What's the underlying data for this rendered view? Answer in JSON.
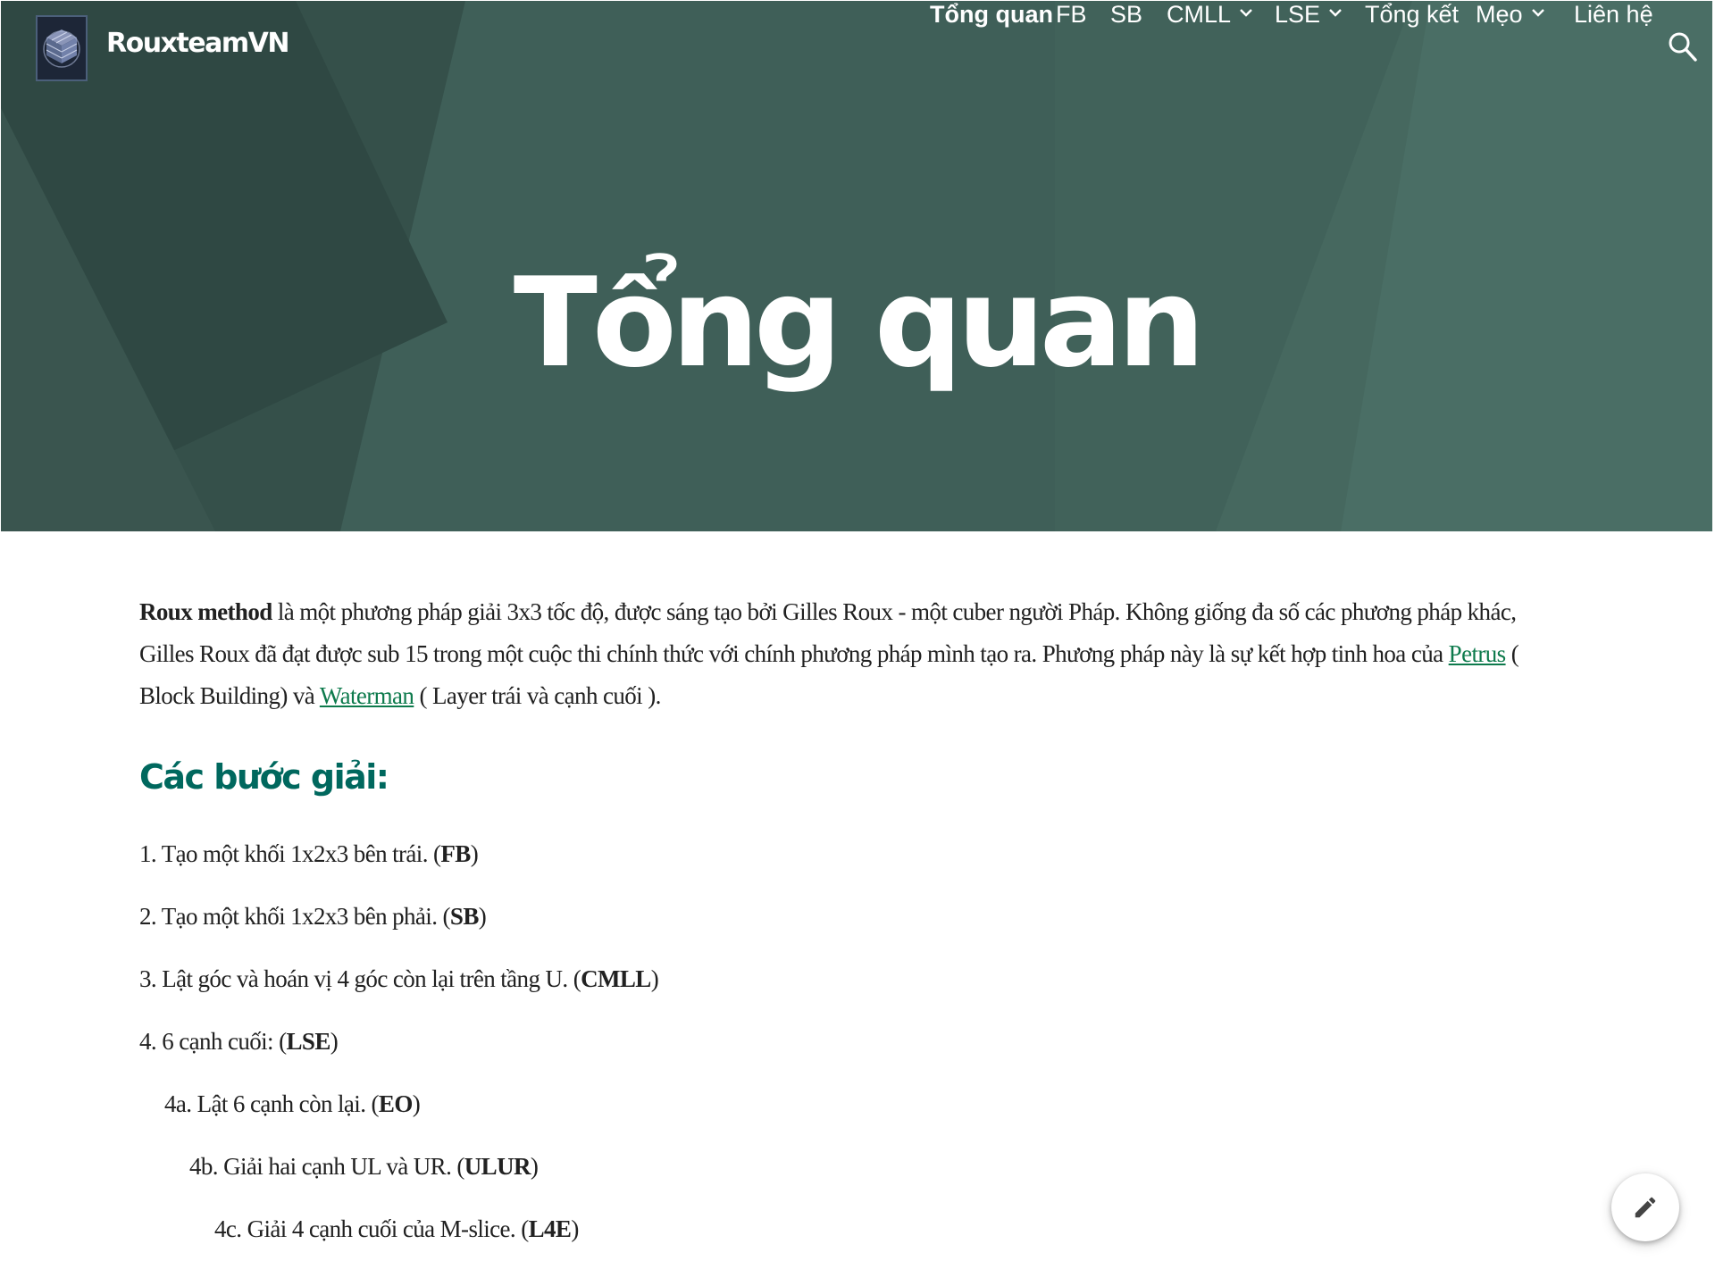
{
  "site": {
    "name": "RouxteamVN",
    "logo_icon": "rubiks-cube-logo"
  },
  "nav": {
    "items": [
      {
        "label": "Tổng quan",
        "active": true,
        "dropdown": false
      },
      {
        "label": "FB",
        "active": false,
        "dropdown": false
      },
      {
        "label": "SB",
        "active": false,
        "dropdown": false
      },
      {
        "label": "CMLL",
        "active": false,
        "dropdown": true
      },
      {
        "label": "LSE",
        "active": false,
        "dropdown": true
      },
      {
        "label": "Tổng kết",
        "active": false,
        "dropdown": false
      },
      {
        "label": "Mẹo",
        "active": false,
        "dropdown": true
      },
      {
        "label": "Liên hệ",
        "active": false,
        "dropdown": false
      }
    ],
    "search_icon": "search-icon"
  },
  "hero": {
    "title": "Tổng quan"
  },
  "intro": {
    "bold": "Roux method",
    "text1": " là một phương pháp giải 3x3 tốc độ, được sáng tạo bởi Gilles Roux - một cuber người Pháp. Không giống đa số các phương pháp khác, Gilles Roux đã đạt được sub 15 trong một cuộc thi chính thức với chính phương pháp mình tạo ra. Phương pháp này là sự kết hợp tinh hoa của ",
    "link1": "Petrus",
    "text2": " ( Block Building) và ",
    "link2": "Waterman",
    "text3": " ( Layer trái và cạnh cuối )."
  },
  "section": {
    "heading": "Các bước giải:"
  },
  "steps": [
    {
      "text": "1. Tạo một khối 1x2x3 bên trái. (",
      "bold": "FB",
      "end": ")"
    },
    {
      "text": "2. Tạo một khối 1x2x3 bên phải. (",
      "bold": "SB",
      "end": ")"
    },
    {
      "text": "3. Lật góc và hoán vị 4 góc còn lại trên tầng U. (",
      "bold": "CMLL",
      "end": ")"
    },
    {
      "text": "4. 6 cạnh cuối: (",
      "bold": "LSE",
      "end": ")"
    },
    {
      "text": "4a. Lật 6 cạnh còn lại. (",
      "bold": "EO",
      "end": ")"
    },
    {
      "text": "4b. Giải hai cạnh UL và UR. (",
      "bold": "ULUR",
      "end": ")"
    },
    {
      "text": "4c. Giải 4 cạnh cuối của M-slice. (",
      "bold": "L4E",
      "end": ")"
    }
  ],
  "fab": {
    "icon": "pencil-edit-icon"
  },
  "colors": {
    "hero_bg": "#3b5a53",
    "heading": "#00685e",
    "link": "#0d7a4c"
  }
}
